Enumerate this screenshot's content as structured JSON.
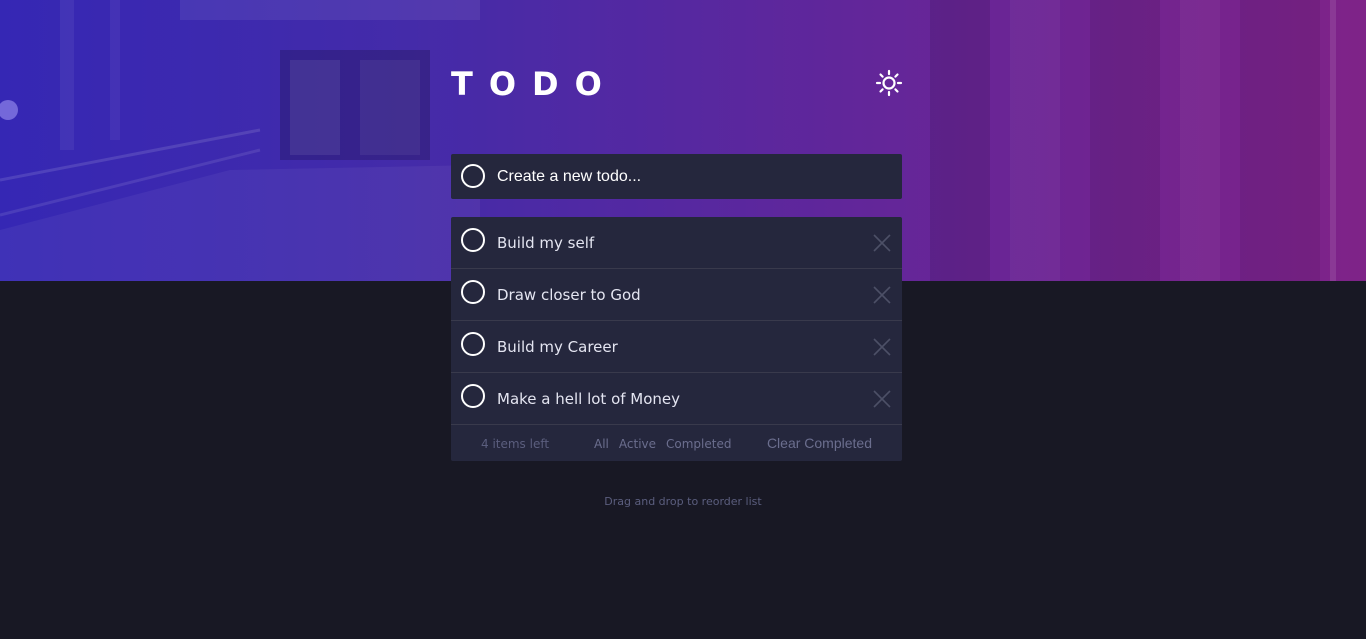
{
  "header": {
    "title": "TODO",
    "theme_toggle_icon": "sun-icon"
  },
  "new_todo": {
    "placeholder": "Create a new todo..."
  },
  "todos": [
    {
      "text": "Build my self",
      "completed": false
    },
    {
      "text": "Draw closer to God",
      "completed": false
    },
    {
      "text": "Build my Career",
      "completed": false
    },
    {
      "text": "Make a hell lot of Money",
      "completed": false
    }
  ],
  "footer": {
    "items_left": "4 items left",
    "filters": [
      "All",
      "Active",
      "Completed"
    ],
    "clear_label": "Clear Completed"
  },
  "hint": "Drag and drop to reorder list",
  "colors": {
    "background": "#181824",
    "card": "#25273d",
    "divider": "#393a4c",
    "muted_text": "#5b5e7e",
    "gradient_start": "#3a2bc4",
    "gradient_end": "#8a2694"
  }
}
